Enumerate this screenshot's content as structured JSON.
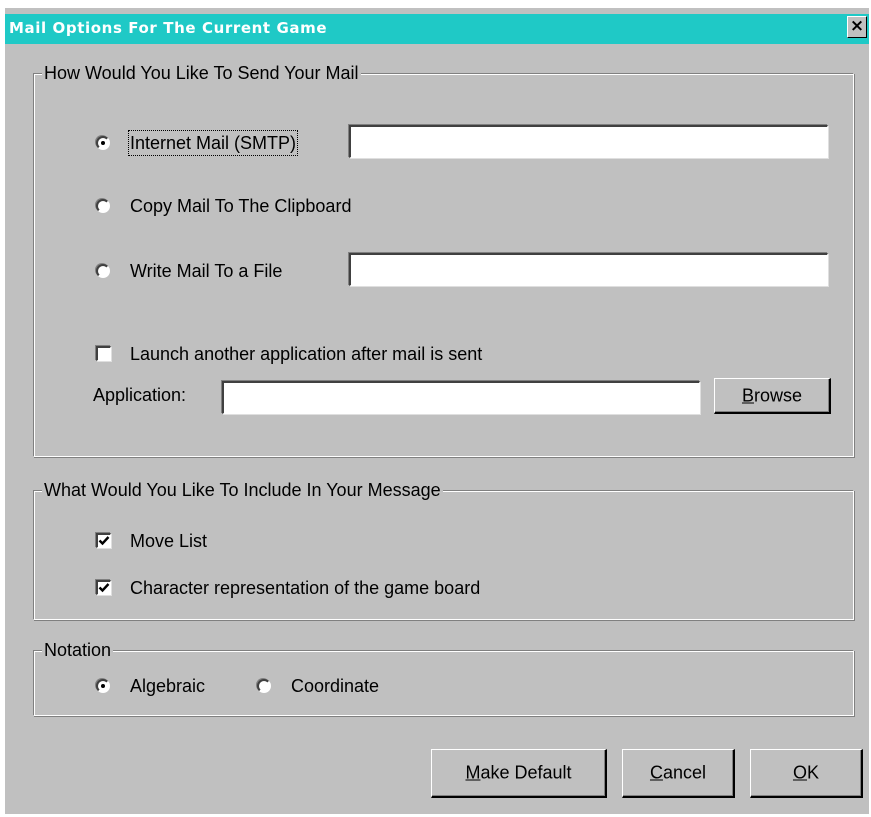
{
  "window": {
    "title": "Mail Options For The Current Game",
    "close_glyph": "×"
  },
  "send_group": {
    "legend": "How Would You Like To Send Your Mail",
    "options": [
      {
        "label": "Internet Mail (SMTP)",
        "selected": true,
        "field_value": ""
      },
      {
        "label": "Copy Mail To The Clipboard",
        "selected": false
      },
      {
        "label": "Write Mail To a File",
        "selected": false,
        "field_value": ""
      }
    ],
    "launch_checkbox": {
      "label": "Launch another application after mail is sent",
      "checked": false
    },
    "application_label": "Application:",
    "application_value": "",
    "browse_label": "Browse"
  },
  "include_group": {
    "legend": "What Would You Like To Include In Your Message",
    "items": [
      {
        "label": "Move List",
        "checked": true
      },
      {
        "label": "Character representation of the game board",
        "checked": true
      }
    ]
  },
  "notation_group": {
    "legend": "Notation",
    "options": [
      {
        "label": "Algebraic",
        "selected": true
      },
      {
        "label": "Coordinate",
        "selected": false
      }
    ]
  },
  "buttons": {
    "make_default": "Make Default",
    "cancel": "Cancel",
    "ok": "OK"
  },
  "colors": {
    "title_bar": "#1fc9c6",
    "face": "#c0c0c0"
  }
}
